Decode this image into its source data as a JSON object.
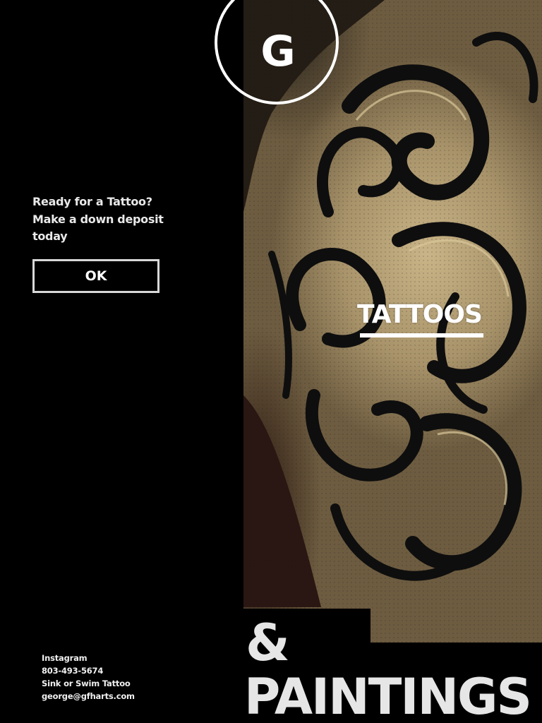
{
  "logo": {
    "letter": "G"
  },
  "promo": {
    "line1": "Ready for a Tattoo?",
    "line2": "Make a down deposit",
    "line3": "today",
    "button_label": "OK"
  },
  "hero": {
    "image_alt_icon": "tattoo-photo",
    "link_label": "TATTOOS"
  },
  "heading": {
    "amp": "&",
    "paintings": "PAINTINGS"
  },
  "contact": {
    "instagram": "Instagram",
    "phone": "803-493-5674",
    "studio": "Sink or Swim Tattoo",
    "email": "george@gfharts.com"
  },
  "colors": {
    "background": "#000000",
    "text": "#ffffff",
    "skin": "#c9b487",
    "ink": "#111111"
  }
}
